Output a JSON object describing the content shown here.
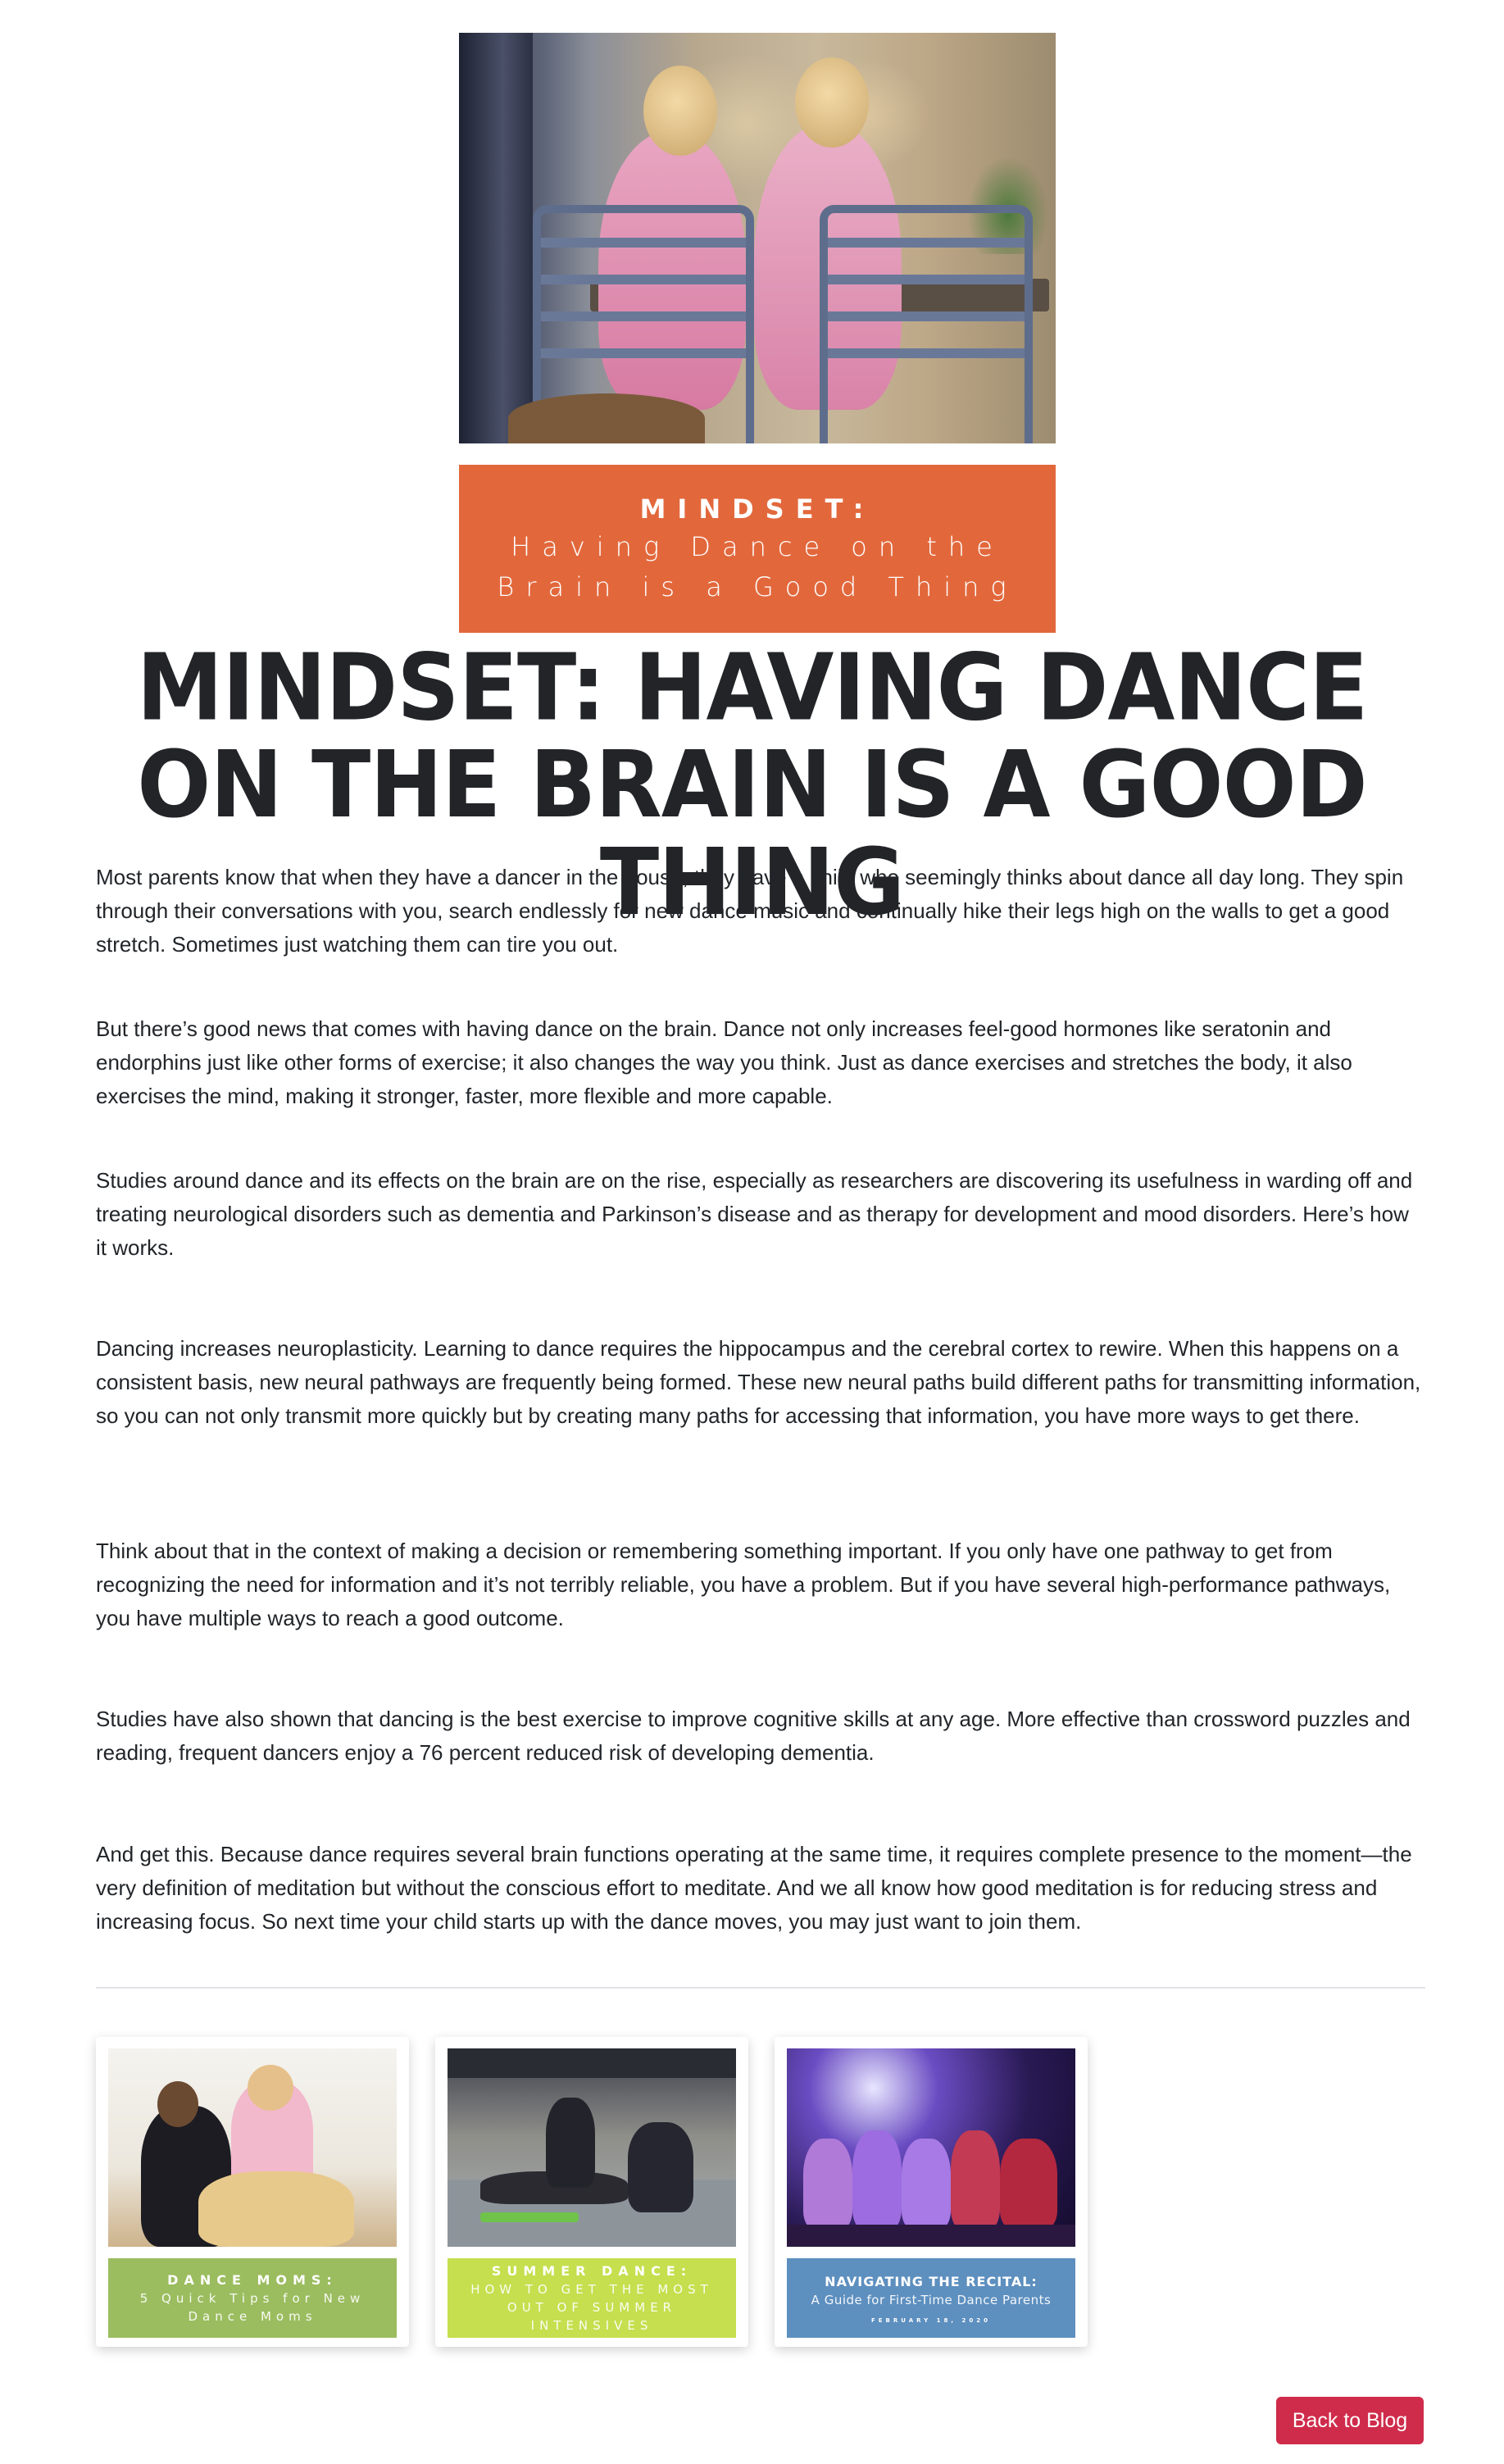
{
  "hero": {
    "image_alt": "Two young dancers in pink leotards sitting at a table",
    "banner_line1": "MINDSET:",
    "banner_line2": "Having Dance on the Brain is a Good Thing"
  },
  "article": {
    "title": "Mindset: Having Dance on the Brain is a Good Thing",
    "paragraphs": [
      "Most parents know that when they have a dancer in the house, they have a child who seemingly thinks about dance all day long. They spin through their conversations with you, search endlessly for new dance music and continually hike their legs high on the walls to get a good stretch. Sometimes just watching them can tire you out.",
      "But there’s good news that comes with having dance on the brain. Dance not only increases feel-good hormones like seratonin and endorphins just like other forms of exercise; it also changes the way you think. Just as dance exercises and stretches the body, it also exercises the mind, making it stronger, faster, more flexible and more capable.",
      "Studies around dance and its effects on the brain are on the rise, especially as researchers are discovering its usefulness in warding off and treating neurological disorders such as dementia and Parkinson’s disease and as therapy for development and mood disorders. Here’s how it works.",
      "Dancing increases neuroplasticity. Learning to dance requires the hippocampus and the cerebral cortex to rewire. When this happens on a consistent basis, new neural pathways are frequently being formed. These new neural paths build different paths for transmitting information, so you can not only transmit more quickly but by creating many paths for accessing that information, you have more ways to get there.",
      "Think about that in the context of making a decision or remembering something important. If you only have one pathway to get from recognizing the need for information and it’s not terribly reliable, you have a problem. But if you have several high-performance pathways, you have multiple ways to reach a good outcome.",
      "Studies have also shown that dancing is the best exercise to improve cognitive skills at any age. More effective than crossword puzzles and reading, frequent dancers enjoy a 76 percent reduced risk of developing dementia.",
      "And get this. Because dance requires several brain functions operating at the same time, it requires complete presence to the moment—the very definition of meditation but without the conscious effort to meditate. And we all know how good meditation is for reducing stress and increasing focus. So next time your child starts up with the dance moves, you may just want to join them."
    ]
  },
  "related": [
    {
      "title": "DANCE MOMS:",
      "subtitle": "5 Quick Tips for New Dance Moms",
      "banner_color": "#9bbd5f"
    },
    {
      "title": "SUMMER DANCE:",
      "subtitle": "HOW TO GET THE MOST OUT OF SUMMER INTENSIVES",
      "banner_color": "#c5df4e"
    },
    {
      "title": "NAVIGATING THE RECITAL:",
      "subtitle": "A Guide for First-Time Dance Parents",
      "date": "FEBRUARY 18, 2020",
      "banner_color": "#5d8fbf"
    }
  ],
  "footer": {
    "back_label": "Back to Blog",
    "back_color": "#cf2c4b"
  },
  "colors": {
    "hero_banner": "#e2683c",
    "text": "#212529"
  }
}
